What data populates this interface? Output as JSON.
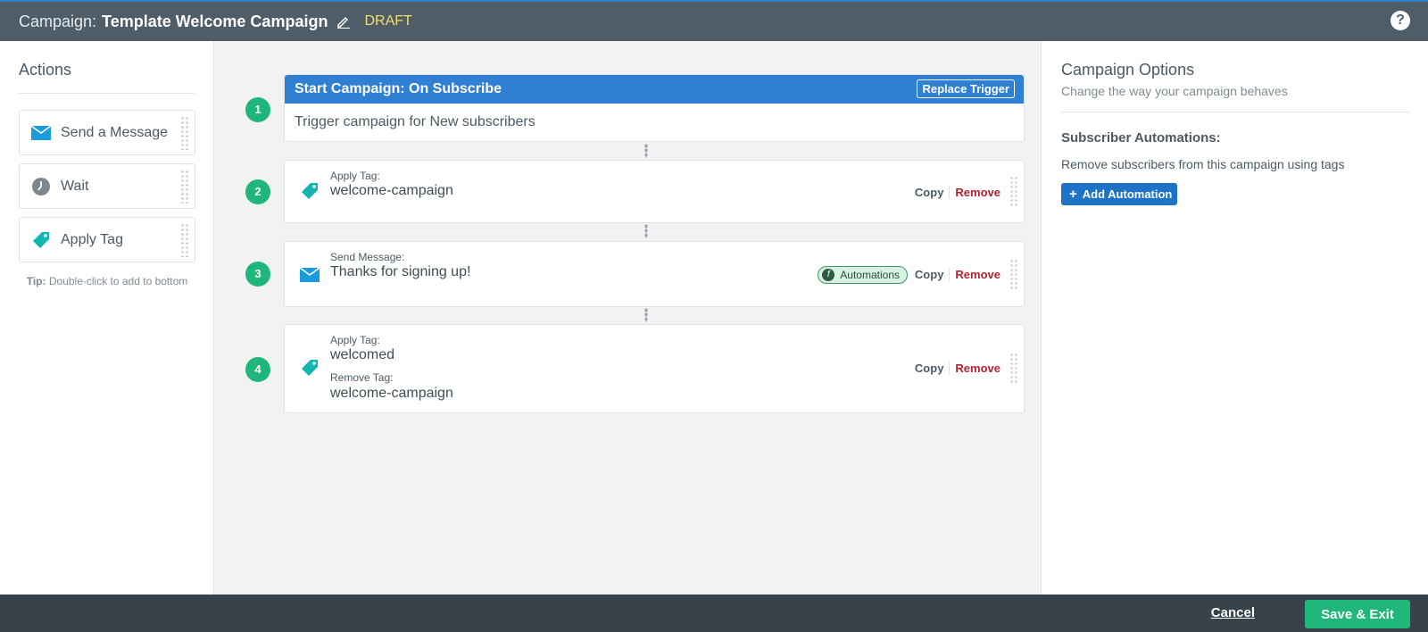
{
  "header": {
    "campaign_label": "Campaign:",
    "title": "Template Welcome Campaign",
    "status": "DRAFT",
    "help_symbol": "?"
  },
  "actions": {
    "title": "Actions",
    "items": [
      {
        "label": "Send a Message",
        "icon": "envelope-icon"
      },
      {
        "label": "Wait",
        "icon": "clock-icon"
      },
      {
        "label": "Apply Tag",
        "icon": "tag-icon"
      }
    ],
    "tip_bold": "Tip:",
    "tip_text": " Double-click to add to bottom"
  },
  "steps": [
    {
      "number": "1",
      "header": "Start Campaign: On Subscribe",
      "replace_label": "Replace Trigger",
      "body": "Trigger campaign for New subscribers"
    },
    {
      "number": "2",
      "label": "Apply Tag:",
      "value": "welcome-campaign",
      "copy_label": "Copy",
      "remove_label": "Remove"
    },
    {
      "number": "3",
      "label": "Send Message:",
      "value": "Thanks for signing up!",
      "badge": "Automations",
      "copy_label": "Copy",
      "remove_label": "Remove"
    },
    {
      "number": "4",
      "label": "Apply Tag:",
      "value": "welcomed",
      "label2": "Remove Tag:",
      "value2": "welcome-campaign",
      "copy_label": "Copy",
      "remove_label": "Remove"
    }
  ],
  "options": {
    "title": "Campaign Options",
    "subtitle": "Change the way your campaign behaves",
    "section_title": "Subscriber Automations:",
    "section_desc": "Remove subscribers from this campaign using tags",
    "add_button_plus": "+",
    "add_button": "Add Automation"
  },
  "footer": {
    "cancel_label": "Cancel",
    "save_label": "Save & Exit"
  },
  "colors": {
    "header_bg": "#4f5d68",
    "accent_blue": "#2f7fd2",
    "step_green": "#1fb67b",
    "tag_teal": "#13b5b1",
    "remove_red": "#b3232f",
    "draft_yellow": "#f1df6e"
  }
}
